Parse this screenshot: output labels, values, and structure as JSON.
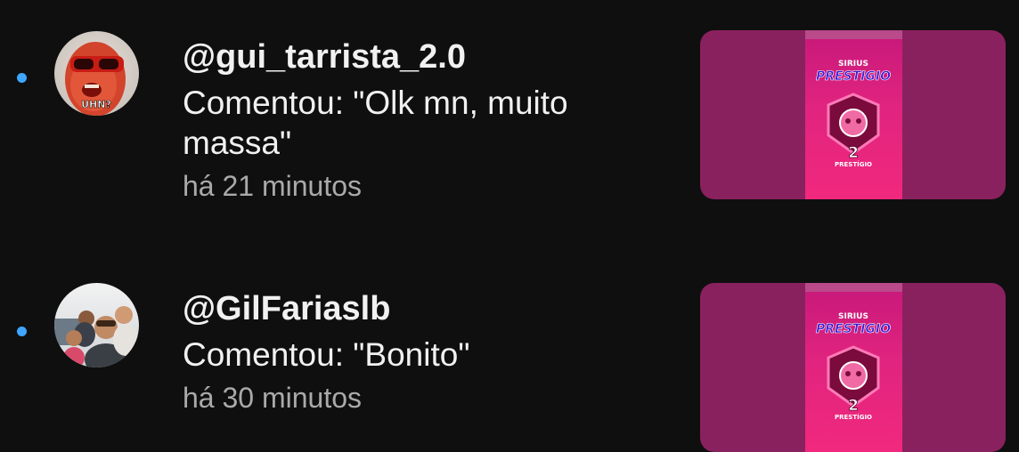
{
  "theme": {
    "background": "#0f0f0f",
    "unread_dot": "#3ea6ff",
    "thumb_blur": "#8a215f",
    "thumb_inner": "#e0247f"
  },
  "notifications": [
    {
      "handle": "@gui_tarrista_2.0",
      "comment": "Comentou: \"Olk mn, muito massa\"",
      "time": "há 21 minutos",
      "avatar_icon": "sunglasses-man-avatar",
      "avatar_caption": "UHN?",
      "thumb": {
        "top_text": "SIRIUS",
        "title": "PRESTIGIO",
        "number": "2",
        "sub_text": "PRESTÍGIO"
      }
    },
    {
      "handle": "@GilFariaslb",
      "comment": "Comentou: \"Bonito\"",
      "time": "há 30 minutos",
      "avatar_icon": "family-photo-avatar",
      "thumb": {
        "top_text": "SIRIUS",
        "title": "PRESTIGIO",
        "number": "2",
        "sub_text": "PRESTÍGIO"
      }
    }
  ]
}
